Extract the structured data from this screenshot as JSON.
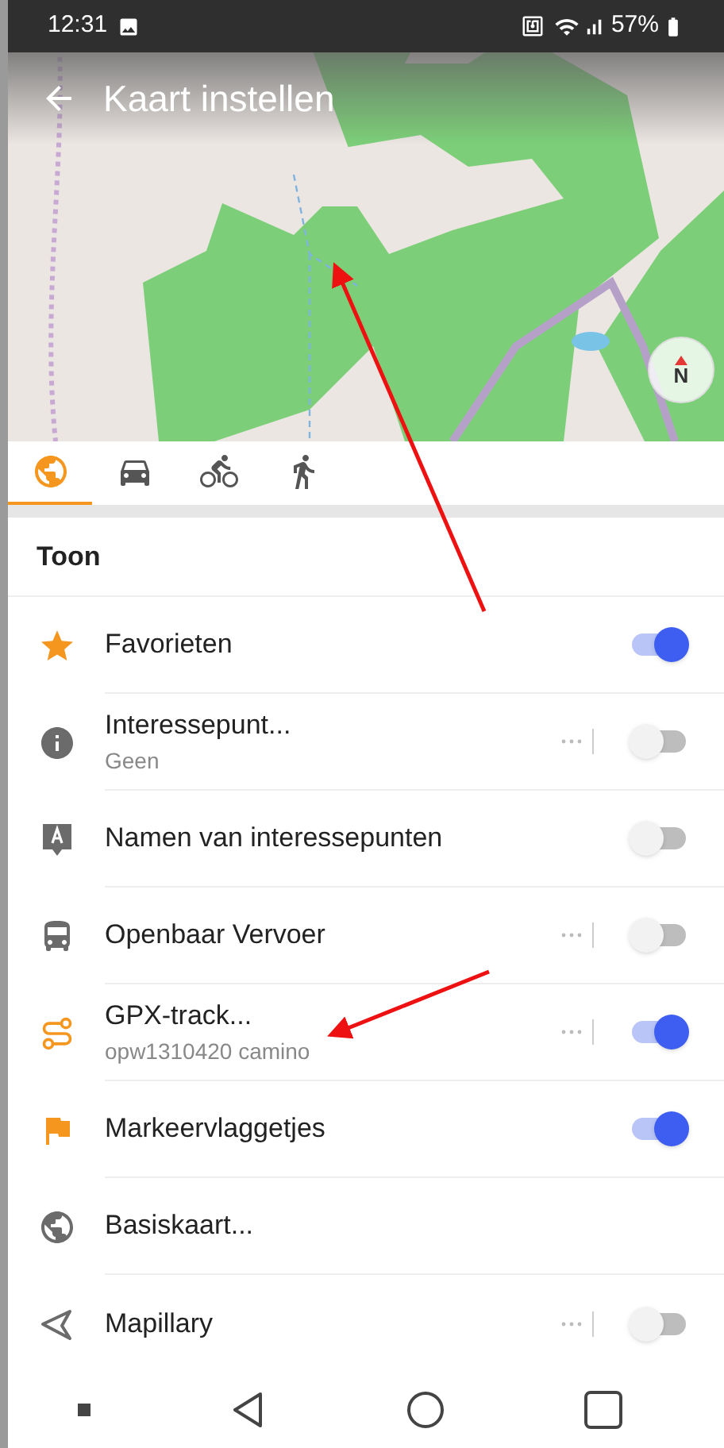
{
  "status_bar": {
    "time": "12:31",
    "battery": "57%"
  },
  "header": {
    "title": "Kaart instellen"
  },
  "map": {
    "compass": "N"
  },
  "tabs": [
    {
      "kind": "globe",
      "selected": true
    },
    {
      "kind": "car",
      "selected": false
    },
    {
      "kind": "bike",
      "selected": false
    },
    {
      "kind": "walk",
      "selected": false
    }
  ],
  "section": {
    "title": "Toon"
  },
  "items": [
    {
      "kind": "toggle",
      "color": "#f5961e",
      "label": "Favorieten",
      "more": false,
      "on": true
    },
    {
      "kind": "toggle",
      "color": "#6b6b6b",
      "label": "Interessepunt...",
      "sublabel": "Geen",
      "more": true,
      "on": false
    },
    {
      "kind": "toggle",
      "color": "#6b6b6b",
      "label": "Namen van interessepunten",
      "more": false,
      "on": false
    },
    {
      "kind": "toggle",
      "color": "#6b6b6b",
      "label": "Openbaar Vervoer",
      "more": true,
      "on": false
    },
    {
      "kind": "toggle",
      "color": "#f5961e",
      "label": "GPX-track...",
      "sublabel": "opw1310420 camino",
      "more": true,
      "on": true
    },
    {
      "kind": "toggle",
      "color": "#f5961e",
      "label": "Markeervlaggetjes",
      "more": false,
      "on": true
    },
    {
      "kind": "link",
      "color": "#6b6b6b",
      "label": "Basiskaart..."
    },
    {
      "kind": "toggle",
      "color": "#6b6b6b",
      "label": "Mapillary",
      "more": true,
      "on": false
    }
  ]
}
